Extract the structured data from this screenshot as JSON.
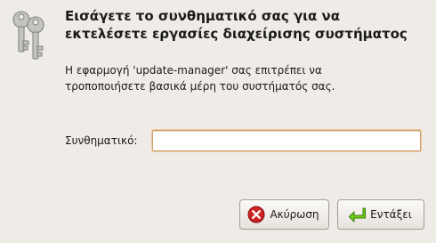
{
  "dialog": {
    "icon": "keys-icon",
    "title_line1": "Εισάγετε το συνθηματικό σας για να",
    "title_line2": "εκτελέσετε εργασίες διαχείρισης συστήματος",
    "description_line1": "Η εφαρμογή 'update-manager' σας επιτρέπει να",
    "description_line2": "τροποποιήσετε βασικά μέρη του συστήματός σας.",
    "password_label": "Συνθηματικό:",
    "password_value": ""
  },
  "buttons": {
    "cancel": {
      "label": "Ακύρωση",
      "icon": "cancel-icon"
    },
    "ok": {
      "label": "Εντάξει",
      "icon": "ok-icon"
    }
  },
  "colors": {
    "background": "#efebe7",
    "input_focus_border": "#c9a173",
    "cancel_icon": "#cc2222",
    "ok_icon": "#4e9a06"
  }
}
